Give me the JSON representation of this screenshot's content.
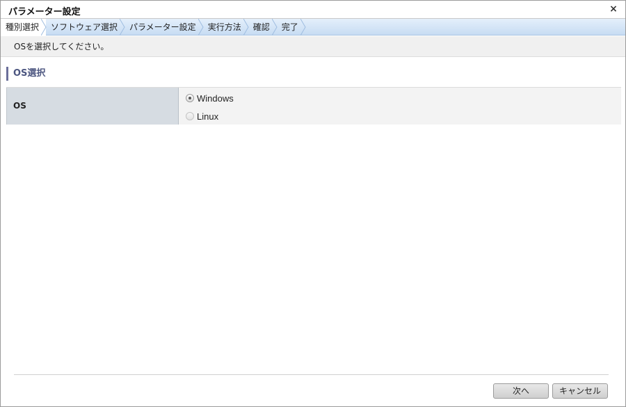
{
  "dialog": {
    "title": "パラメーター設定",
    "close_glyph": "×"
  },
  "steps": [
    {
      "label": "種別選択",
      "active": true
    },
    {
      "label": "ソフトウェア選択",
      "active": false
    },
    {
      "label": "パラメーター設定",
      "active": false
    },
    {
      "label": "実行方法",
      "active": false
    },
    {
      "label": "確認",
      "active": false
    },
    {
      "label": "完了",
      "active": false
    }
  ],
  "instruction": "OSを選択してください。",
  "section": {
    "heading": "OS選択"
  },
  "form": {
    "label": "OS",
    "options": [
      {
        "label": "Windows",
        "checked": true
      },
      {
        "label": "Linux",
        "checked": false
      }
    ]
  },
  "buttons": {
    "next": "次へ",
    "cancel": "キャンセル"
  },
  "colors": {
    "step_bar": "#c7dcf3",
    "section_accent": "#6b6f9a",
    "label_cell": "#d6dce2"
  }
}
